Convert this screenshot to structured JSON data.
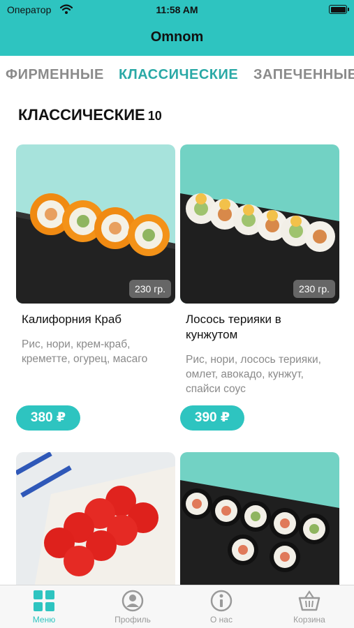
{
  "status_bar": {
    "carrier": "Оператор",
    "time": "11:58 AM"
  },
  "header": {
    "title": "Omnom"
  },
  "category_tabs": [
    {
      "label": "ФИРМЕННЫЕ",
      "active": false
    },
    {
      "label": "КЛАССИЧЕСКИЕ",
      "active": true
    },
    {
      "label": "ЗАПЕЧЕННЫЕ",
      "active": false
    }
  ],
  "section": {
    "title": "КЛАССИЧЕСКИЕ",
    "count": "10"
  },
  "products": [
    {
      "name": "Калифорния Краб",
      "description": "Рис, нори, крем-краб, креметте, огурец, масаго",
      "weight": "230 гр.",
      "price": "380 ₽"
    },
    {
      "name": "Лосось терияки в кунжутом",
      "description": "Рис, нори, лосось терияки, омлет, авокадо, кунжут, спайси соус",
      "weight": "230 гр.",
      "price": "390 ₽"
    },
    {
      "name": "",
      "description": "",
      "weight": "",
      "price": ""
    },
    {
      "name": "",
      "description": "",
      "weight": "",
      "price": ""
    }
  ],
  "tabbar": [
    {
      "label": "Меню",
      "icon": "grid-icon",
      "active": true
    },
    {
      "label": "Профиль",
      "icon": "profile-icon",
      "active": false
    },
    {
      "label": "О нас",
      "icon": "info-icon",
      "active": false
    },
    {
      "label": "Корзина",
      "icon": "basket-icon",
      "active": false
    }
  ],
  "colors": {
    "accent": "#2ec4c0",
    "active_tab_text": "#2aa9a6",
    "inactive_text": "#8b8b8b"
  }
}
